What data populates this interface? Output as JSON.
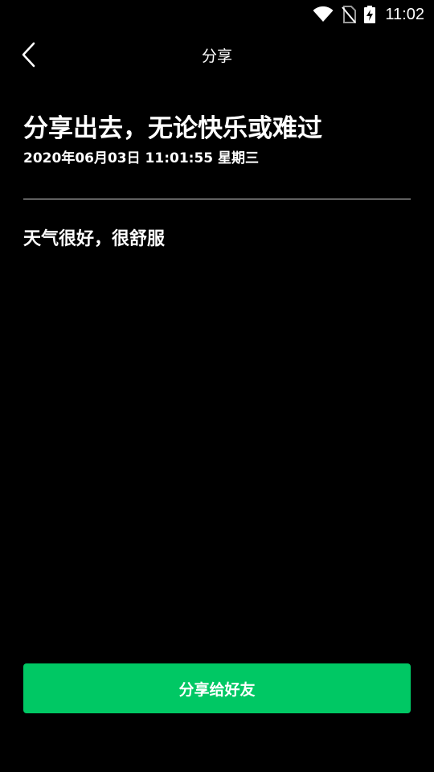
{
  "status_bar": {
    "time": "11:02",
    "icons": [
      "wifi-icon",
      "no-sim-icon",
      "battery-charging-icon"
    ]
  },
  "header": {
    "back_icon": "chevron-left-icon",
    "title": "分享"
  },
  "post": {
    "headline": "分享出去，无论快乐或难过",
    "datetime": "2020年06月03日 11:01:55 星期三",
    "body": "天气很好，很舒服"
  },
  "actions": {
    "share_label": "分享给好友"
  },
  "colors": {
    "background": "#000000",
    "text": "#ffffff",
    "accent": "#00c864",
    "divider": "#d9d9d9"
  }
}
